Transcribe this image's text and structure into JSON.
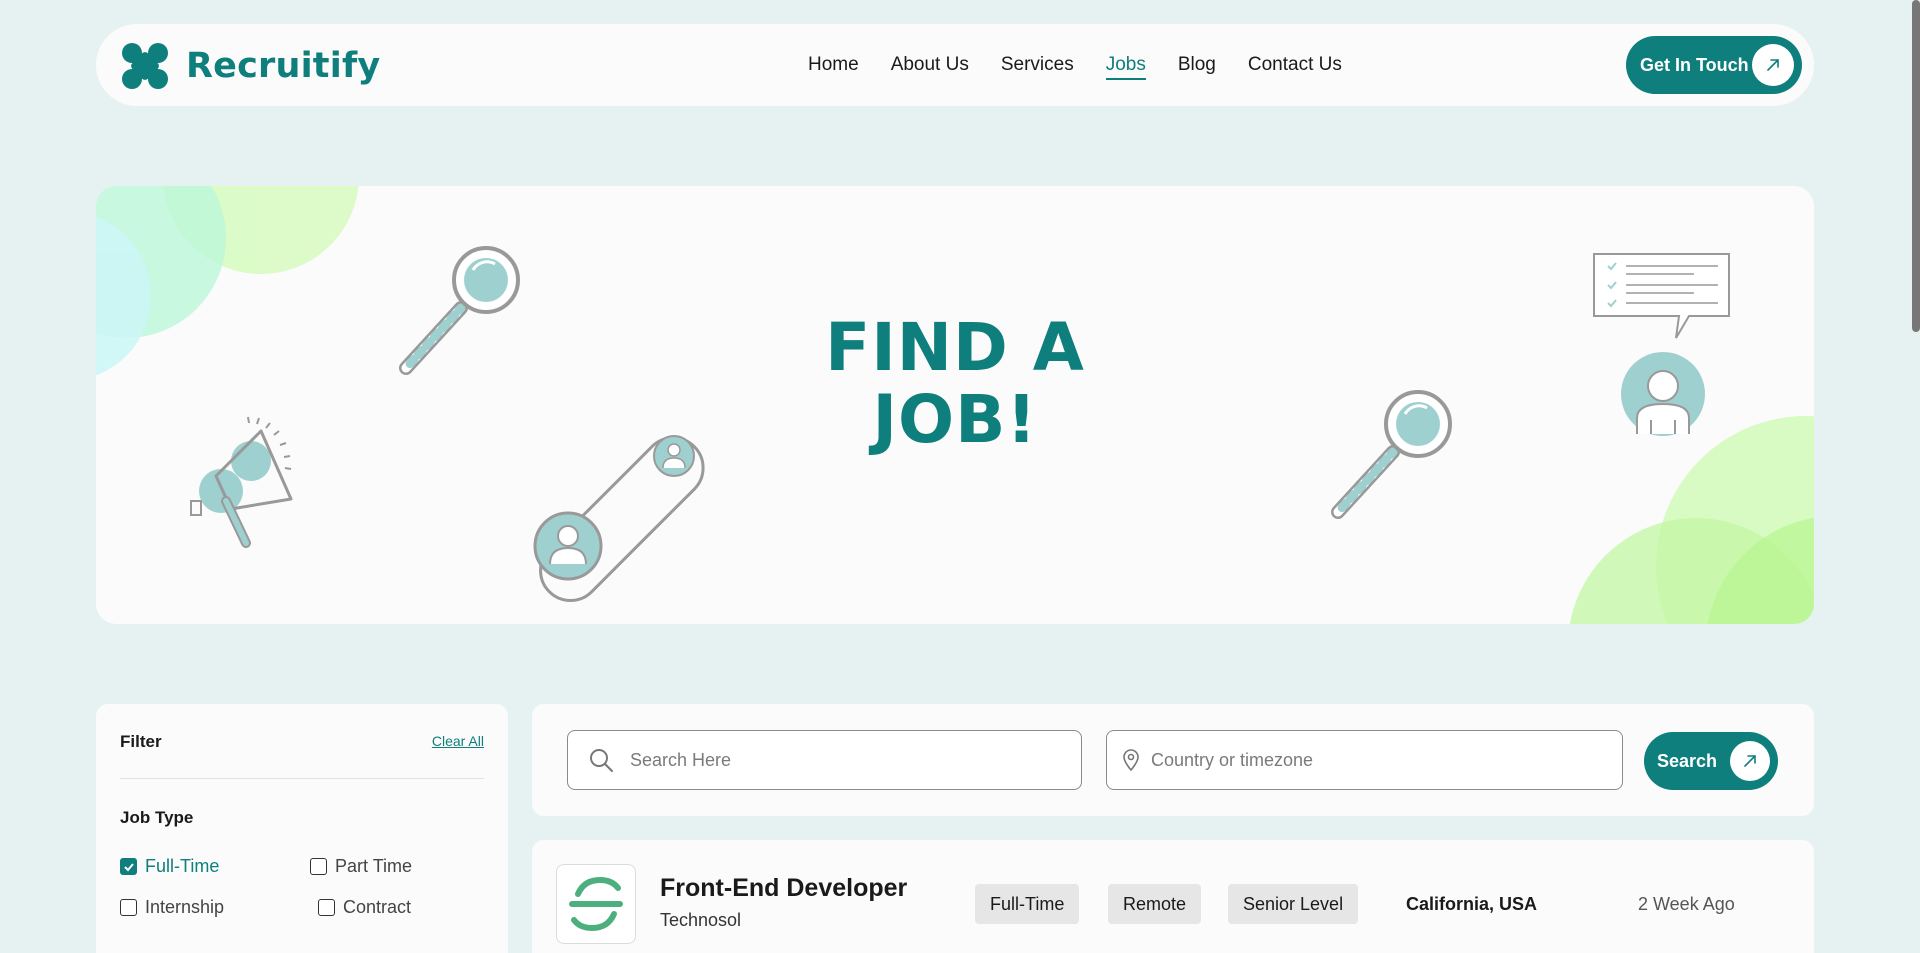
{
  "brand": {
    "name": "Recruitify",
    "color": "#0e7f7c"
  },
  "nav": {
    "items": [
      {
        "label": "Home",
        "active": false
      },
      {
        "label": "About Us",
        "active": false
      },
      {
        "label": "Services",
        "active": false
      },
      {
        "label": "Jobs",
        "active": true
      },
      {
        "label": "Blog",
        "active": false
      },
      {
        "label": "Contact Us",
        "active": false
      }
    ],
    "cta_label": "Get In Touch"
  },
  "hero": {
    "title_line1": "FIND A",
    "title_line2": "JOB!"
  },
  "filter": {
    "title": "Filter",
    "clear_label": "Clear All",
    "job_type_title": "Job Type",
    "options": [
      {
        "label": "Full-Time",
        "checked": true
      },
      {
        "label": "Part Time",
        "checked": false
      },
      {
        "label": "Internship",
        "checked": false
      },
      {
        "label": "Contract",
        "checked": false
      }
    ]
  },
  "search": {
    "keyword_placeholder": "Search Here",
    "location_placeholder": "Country or timezone",
    "button_label": "Search"
  },
  "jobs": [
    {
      "title": "Front-End Developer",
      "company": "Technosol",
      "tags": [
        "Full-Time",
        "Remote",
        "Senior Level"
      ],
      "location": "California, USA",
      "posted": "2 Week Ago"
    }
  ],
  "icons": [
    "logo-icon",
    "arrow-up-right-icon",
    "search-icon",
    "location-pin-icon",
    "magnifier-illustration",
    "megaphone-illustration",
    "checklist-bubble-illustration",
    "user-avatar-illustration"
  ]
}
